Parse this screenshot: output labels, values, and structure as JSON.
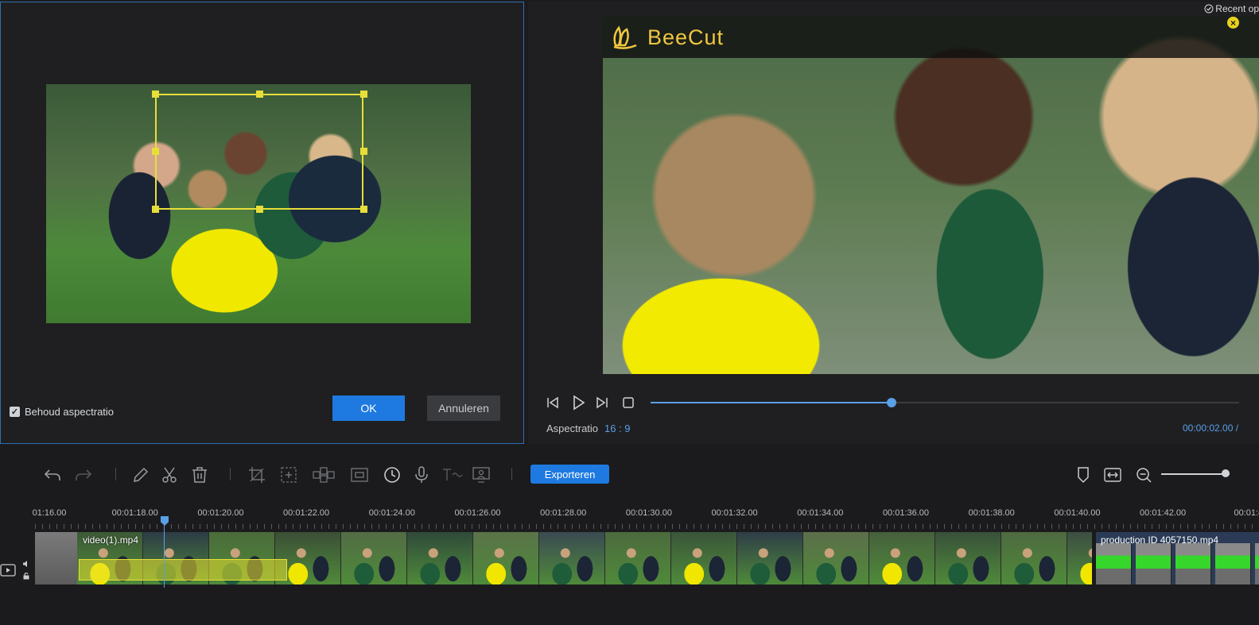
{
  "crop_dialog": {
    "keep_aspect_label": "Behoud aspectratio",
    "keep_aspect_checked": true,
    "ok_label": "OK",
    "cancel_label": "Annuleren"
  },
  "preview": {
    "logo_text": "BeeCut",
    "recent_label": "Recent op",
    "aspect_label": "Aspectratio",
    "aspect_value": "16 : 9",
    "timecode": "00:00:02.00  /",
    "progress": 0.41
  },
  "toolbar": {
    "export_label": "Exporteren",
    "zoom_level": 0.94
  },
  "timeline": {
    "ticks": [
      "01:16.00",
      "00:01:18.00",
      "00:01:20.00",
      "00:01:22.00",
      "00:01:24.00",
      "00:01:26.00",
      "00:01:28.00",
      "00:01:30.00",
      "00:01:32.00",
      "00:01:34.00",
      "00:01:36.00",
      "00:01:38.00",
      "00:01:40.00",
      "00:01:42.00",
      "00:01:4"
    ],
    "clip_main_name": "video(1).mp4",
    "clip_second_name": "production ID 4057150.mp4"
  },
  "colors": {
    "accent": "#1e7ae0",
    "crop_yellow": "#e8de39",
    "progress_blue": "#5aa0e6"
  }
}
